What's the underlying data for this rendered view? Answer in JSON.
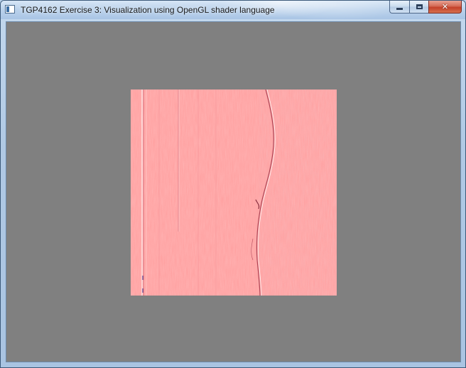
{
  "window": {
    "title": "TGP4162 Exercise 3: Visualization using OpenGL shader language",
    "icon": "app-window-icon",
    "controls": {
      "minimize_icon": "minimize-icon",
      "maximize_icon": "maximize-icon",
      "close_label": "✕"
    }
  },
  "viewport": {
    "background_color": "#808080",
    "texture_tint": "#ffa0a0",
    "content": "embossed-texture-quad"
  }
}
